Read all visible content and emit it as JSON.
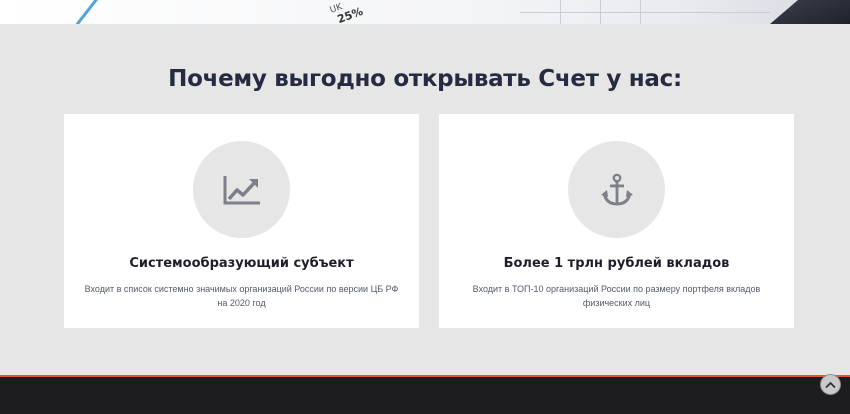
{
  "hero": {
    "sheet_label": "UK",
    "sheet_value": "25%"
  },
  "section": {
    "title": "Почему выгодно открывать Счет у нас:"
  },
  "cards": [
    {
      "icon": "chart-line-up-icon",
      "title": "Системообразующий субъект",
      "text": "Входит в список системно значимых организаций России по версии ЦБ РФ на 2020 год"
    },
    {
      "icon": "anchor-icon",
      "title": "Более 1 трлн рублей вкладов",
      "text": "Входит в ТОП-10 организаций России по размеру портфеля вкладов физических лиц"
    }
  ],
  "colors": {
    "background": "#e6e6e6",
    "card": "#ffffff",
    "title": "#262b43",
    "icon": "#7d7f89",
    "footer": "#1d1d1f",
    "footer_accent": "#e0572d"
  },
  "scroll_top": {
    "icon": "chevron-up-icon"
  }
}
